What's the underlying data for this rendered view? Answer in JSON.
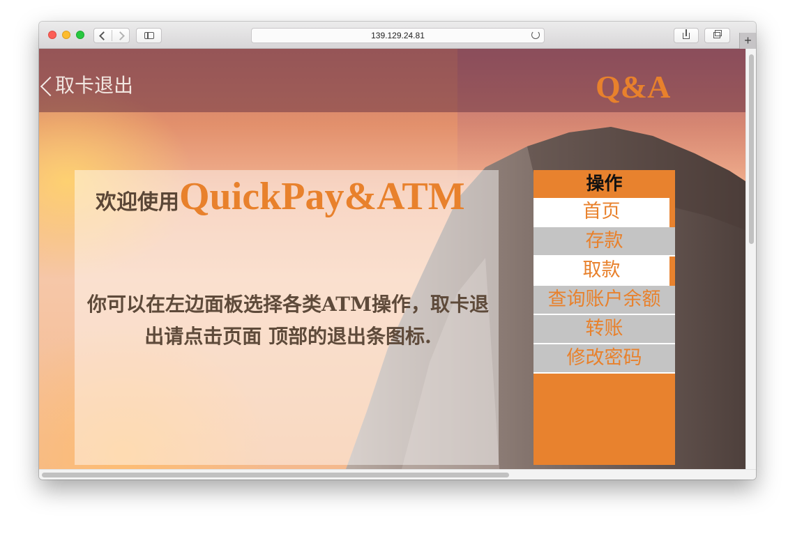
{
  "browser": {
    "url": "139.129.24.81"
  },
  "header": {
    "back_label": "取卡退出",
    "title": "Q&A"
  },
  "welcome": {
    "prefix": "欢迎使用",
    "brand": "QuickPay&ATM",
    "description": "你可以在左边面板选择各类ATM操作，取卡退出请点击页面 顶部的退出条图标."
  },
  "operations": {
    "title": "操作",
    "items": [
      {
        "label": "首页"
      },
      {
        "label": "存款"
      },
      {
        "label": "取款"
      },
      {
        "label": "查询账户余额"
      },
      {
        "label": "转账"
      },
      {
        "label": "修改密码"
      }
    ]
  },
  "colors": {
    "accent": "#e8812c",
    "panel_bg": "#e8822e",
    "item_grey": "#c4c4c4"
  }
}
